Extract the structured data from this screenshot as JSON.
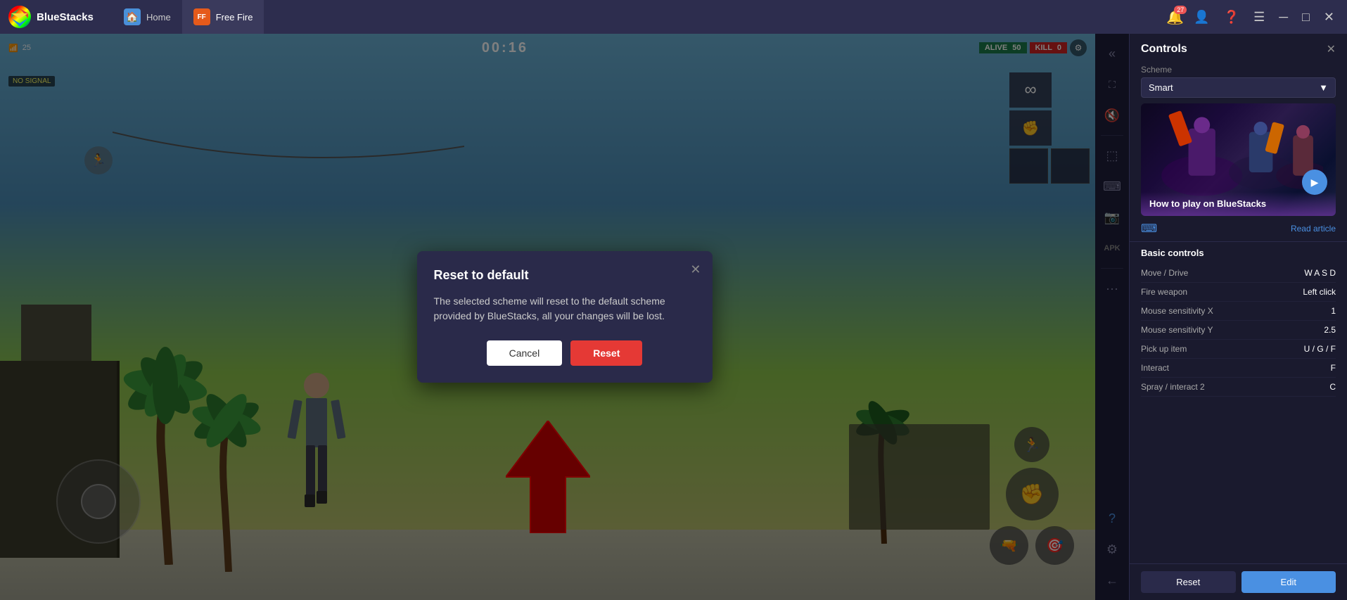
{
  "app": {
    "name": "BlueStacks",
    "tabs": [
      {
        "id": "home",
        "label": "Home",
        "active": false
      },
      {
        "id": "freefire",
        "label": "Free Fire",
        "active": true
      }
    ],
    "notification_count": "27",
    "topbar_buttons": [
      "minimize",
      "maximize",
      "close",
      "collapse"
    ]
  },
  "game": {
    "timer": "00:16",
    "wifi_level": "25",
    "alive_label": "ALIVE",
    "alive_count": "50",
    "kill_label": "KILL",
    "kill_count": "0",
    "no_signal": "NO SIGNAL"
  },
  "modal": {
    "title": "Reset to default",
    "body": "The selected scheme will reset to the default scheme provided by BlueStacks, all your changes will be lost.",
    "cancel_label": "Cancel",
    "reset_label": "Reset"
  },
  "controls_panel": {
    "title": "Controls",
    "scheme_label": "Scheme",
    "scheme_value": "Smart",
    "preview_text": "How to play on BlueStacks",
    "read_article": "Read article",
    "basic_controls_title": "Basic controls",
    "controls": [
      {
        "name": "Move / Drive",
        "key": "W A S D"
      },
      {
        "name": "Fire weapon",
        "key": "Left click"
      },
      {
        "name": "Mouse sensitivity X",
        "key": "1"
      },
      {
        "name": "Mouse sensitivity Y",
        "key": "2.5"
      },
      {
        "name": "Pick up item",
        "key": "U / G / F"
      },
      {
        "name": "Interact",
        "key": "F"
      },
      {
        "name": "Spray / interact 2",
        "key": "C"
      }
    ],
    "reset_label": "Reset",
    "edit_label": "Edit"
  }
}
